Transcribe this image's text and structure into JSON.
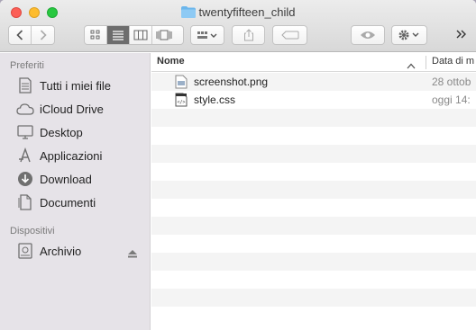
{
  "window": {
    "title": "twentyfifteen_child"
  },
  "toolbar": {
    "nav_buttons": [
      "back",
      "forward"
    ],
    "view_modes": [
      "icon",
      "list",
      "column",
      "coverflow"
    ],
    "active_view": "list"
  },
  "sidebar": {
    "favorites_header": "Preferiti",
    "favorites": [
      {
        "label": "Tutti i miei file",
        "icon": "all-files-icon"
      },
      {
        "label": "iCloud Drive",
        "icon": "cloud-icon"
      },
      {
        "label": "Desktop",
        "icon": "desktop-icon"
      },
      {
        "label": "Applicazioni",
        "icon": "applications-icon"
      },
      {
        "label": "Download",
        "icon": "download-icon"
      },
      {
        "label": "Documenti",
        "icon": "documents-icon"
      }
    ],
    "devices_header": "Dispositivi",
    "devices": [
      {
        "label": "Archivio",
        "icon": "disk-icon"
      }
    ]
  },
  "list": {
    "columns": {
      "name": "Nome",
      "date": "Data di m"
    },
    "files": [
      {
        "name": "screenshot.png",
        "date": "28 ottob",
        "icon": "png-file-icon"
      },
      {
        "name": "style.css",
        "date": "oggi 14:",
        "icon": "css-file-icon"
      }
    ]
  },
  "colors": {
    "sidebar_bg": "#e6e3e8",
    "row_alt": "#f4f4f4",
    "close": "#fc5f57",
    "minimize": "#fdbc2e",
    "maximize": "#28c840",
    "folder": "#6bb6ec"
  }
}
